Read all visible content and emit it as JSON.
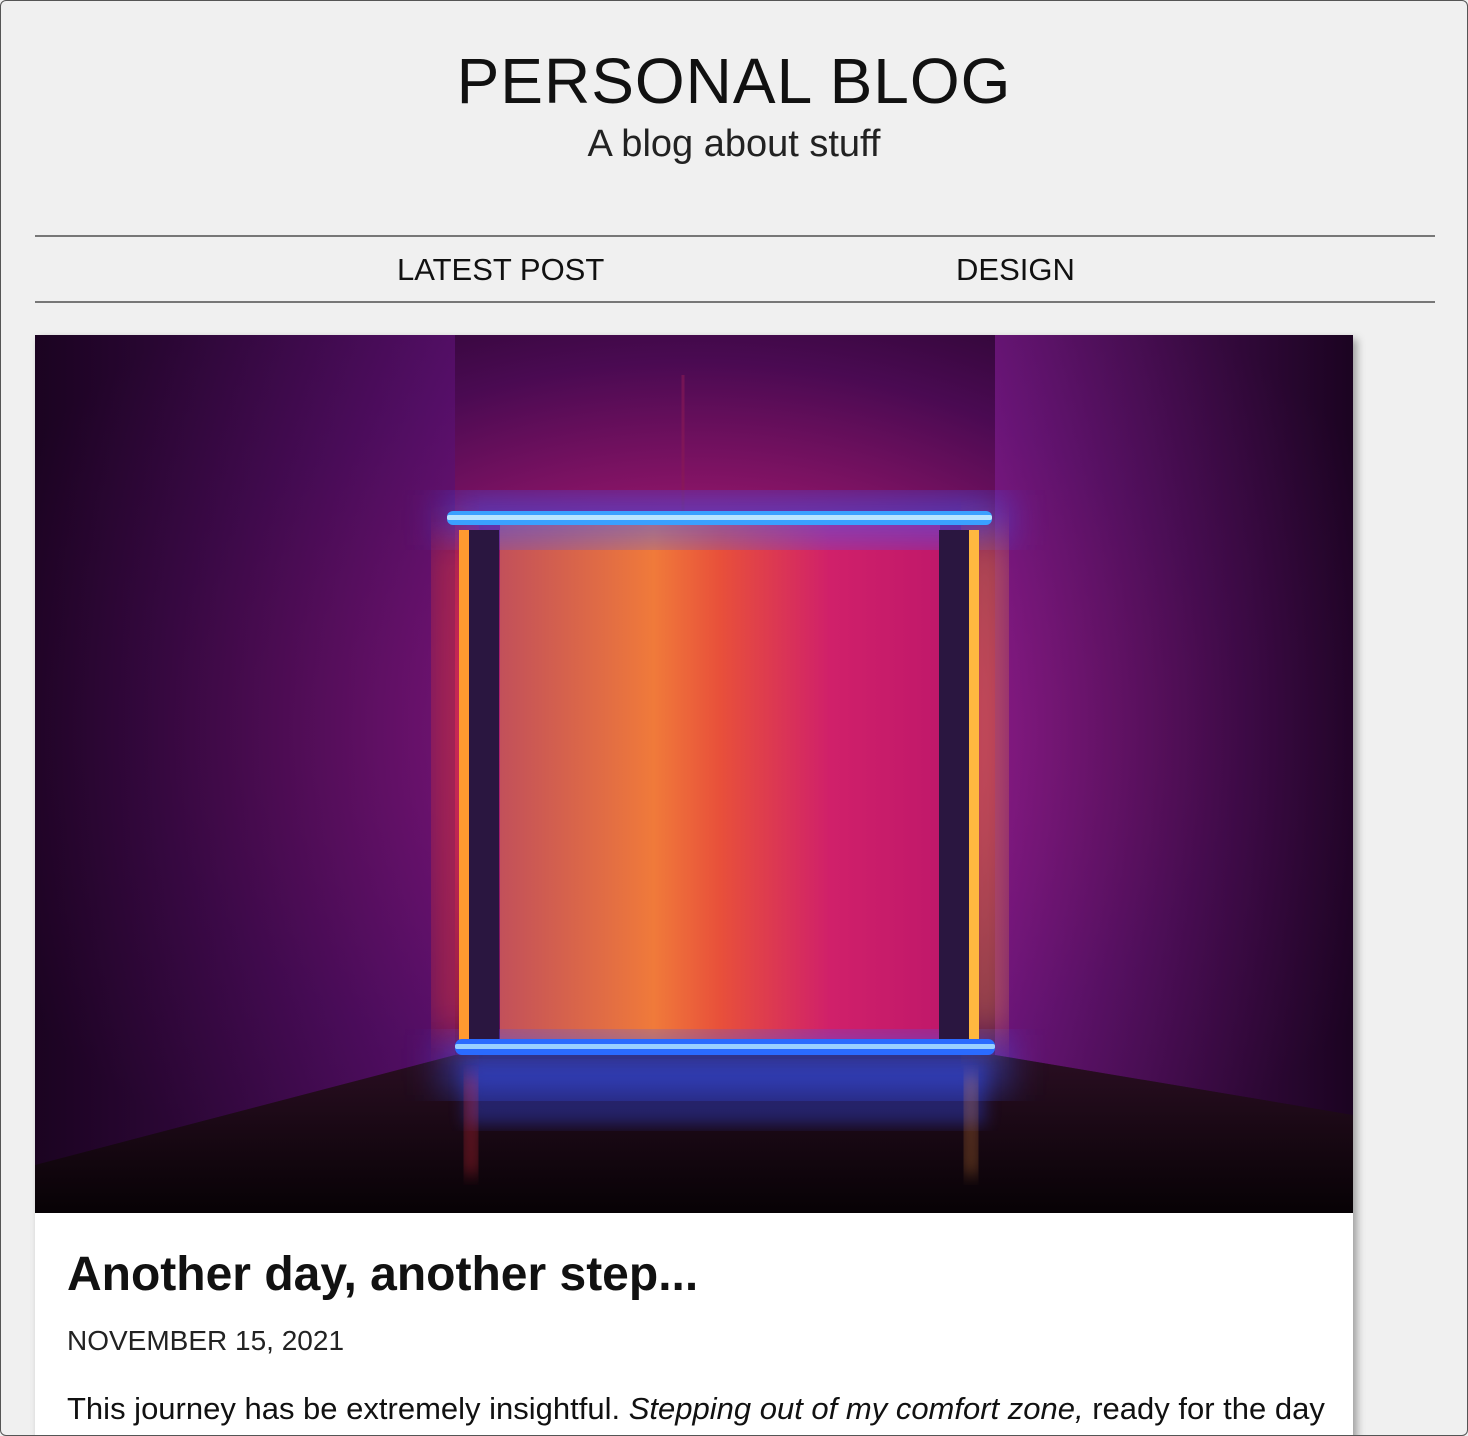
{
  "header": {
    "title": "PERSONAL BLOG",
    "subtitle": "A blog about stuff"
  },
  "nav": {
    "items": [
      {
        "label": "LATEST POST"
      },
      {
        "label": "DESIGN"
      }
    ]
  },
  "post": {
    "image_icon": "neon-light-sculpture-image",
    "title": "Another day, another step...",
    "date": "NOVEMBER 15, 2021",
    "excerpt_start": "This journey has be extremely insightful. ",
    "excerpt_italic": "Stepping out of my comfort zone,",
    "excerpt_end": " ready for the day"
  },
  "colors": {
    "page_background": "#f0f0f0",
    "card_background": "#ffffff",
    "neon_blue": "#2a6bff",
    "neon_orange": "#ff9a2a",
    "wall_purple": "#3a0a4a"
  }
}
